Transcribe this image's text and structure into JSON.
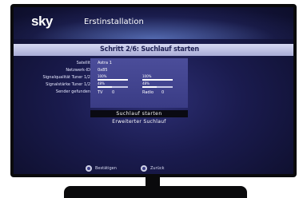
{
  "header": {
    "logo": "sky",
    "title": "Erstinstallation"
  },
  "step": {
    "title": "Schritt 2/6: Suchlauf starten"
  },
  "fields": [
    {
      "label": "Satellit",
      "value": "Astra 1"
    },
    {
      "label": "Netzwerk-ID",
      "value": "0x85"
    },
    {
      "label": "Signalqualität Tuner 1/2"
    },
    {
      "label": "Signalstärke Tuner 1/2"
    },
    {
      "label": "Sender gefunden"
    }
  ],
  "meters": {
    "quality": [
      {
        "pct_label": "100%",
        "fraction": 1.0
      },
      {
        "pct_label": "100%",
        "fraction": 1.0
      }
    ],
    "strength": [
      {
        "pct_label": "48%",
        "fraction": 0.48
      },
      {
        "pct_label": "48%",
        "fraction": 0.48
      }
    ]
  },
  "found": {
    "tv_label": "TV",
    "tv_count": "0",
    "radio_label": "Radio",
    "radio_count": "0"
  },
  "actions": {
    "start": "Suchlauf starten",
    "advanced": "Erweiterter Suchlauf"
  },
  "footer": {
    "confirm": "Bestätigen",
    "back": "Zurück"
  },
  "colors": {
    "accent": "#2d2f74",
    "panel": "#3a3c85"
  }
}
